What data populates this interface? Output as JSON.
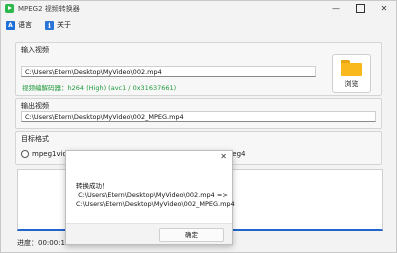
{
  "window": {
    "title": "MPEG2 视频转换器",
    "minimize": "—",
    "close": "✕"
  },
  "menu": {
    "language": {
      "icon_text": "A",
      "label": "语言"
    },
    "about": {
      "icon_text": "i",
      "label": "关于"
    }
  },
  "input": {
    "label": "输入视频",
    "path": "C:\\Users\\Etern\\Desktop\\MyVideo\\002.mp4",
    "codec": "视频编解码器：h264 (High) (avc1 / 0x31637661)",
    "browse_label": "浏览"
  },
  "output": {
    "label": "输出视频",
    "path": "C:\\Users\\Etern\\Desktop\\MyVideo\\002_MPEG.mp4"
  },
  "format": {
    "label": "目标格式",
    "option1": "mpeg1video",
    "option2": "mpeg4"
  },
  "progress": "进度：00:00:13.8",
  "dialog": {
    "close": "✕",
    "message": "转换成功！\n C:\\Users\\Etern\\Desktop\\MyVideo\\002.mp4 =>\nC:\\Users\\Etern\\Desktop\\MyVideo\\002_MPEG.mp4",
    "ok_label": "确定"
  },
  "colors": {
    "accent": "#2266cc",
    "codec_text": "#1f9a3a",
    "folder": "#f9b91c"
  },
  "icons": [
    "app-icon",
    "language-icon",
    "info-icon",
    "folder-icon"
  ]
}
